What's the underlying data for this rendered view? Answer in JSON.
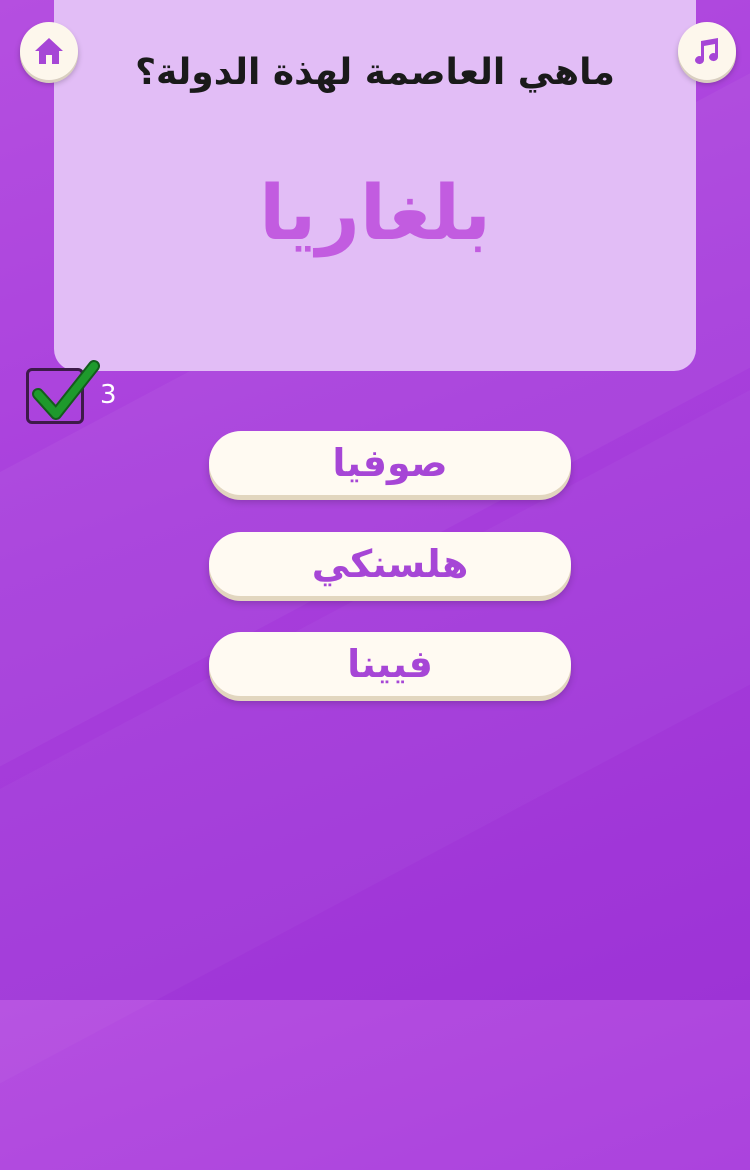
{
  "question": {
    "prompt": "ماهي العاصمة لهذة الدولة؟",
    "country": "بلغاريا"
  },
  "score": {
    "correct_count": "3"
  },
  "answers": [
    {
      "label": "صوفيا"
    },
    {
      "label": "هلسنكي"
    },
    {
      "label": "فيينا"
    }
  ],
  "icons": {
    "home": "home-icon",
    "music": "music-icon",
    "check": "checkmark-icon"
  },
  "colors": {
    "background": "#a83fdc",
    "card": "#e2bdf6",
    "country_text": "#c25ce0",
    "answer_text": "#a646d6",
    "check": "#1e9a2c"
  }
}
